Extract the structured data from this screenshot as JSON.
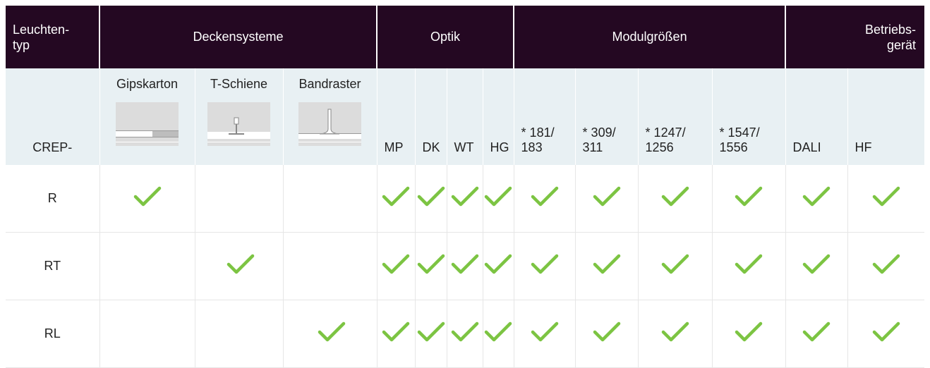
{
  "header": {
    "typ": "Leuchten-\ntyp",
    "deckensysteme": "Deckensysteme",
    "optik": "Optik",
    "modulgroessen": "Modulgrößen",
    "betriebsgeraet": "Betriebs-\ngerät"
  },
  "sub": {
    "prefix": "CREP-",
    "gipskarton": "Gipskarton",
    "tschiene": "T-Schiene",
    "bandraster": "Bandraster",
    "mp": "MP",
    "dk": "DK",
    "wt": "WT",
    "hg": "HG",
    "m1": "* 181/\n183",
    "m2": "* 309/\n311",
    "m3": "* 1247/\n1256",
    "m4": "* 1547/\n1556",
    "dali": "DALI",
    "hf": "HF"
  },
  "rows": [
    {
      "type": "R",
      "checks": [
        true,
        false,
        false,
        true,
        true,
        true,
        true,
        true,
        true,
        true,
        true,
        true,
        true
      ]
    },
    {
      "type": "RT",
      "checks": [
        false,
        true,
        false,
        true,
        true,
        true,
        true,
        true,
        true,
        true,
        true,
        true,
        true
      ]
    },
    {
      "type": "RL",
      "checks": [
        false,
        false,
        true,
        true,
        true,
        true,
        true,
        true,
        true,
        true,
        true,
        true,
        true
      ]
    }
  ],
  "colors": {
    "header_bg": "#240822",
    "sub_bg": "#e8f0f3",
    "check": "#7cc442"
  },
  "icons": {
    "check": "check-icon"
  }
}
